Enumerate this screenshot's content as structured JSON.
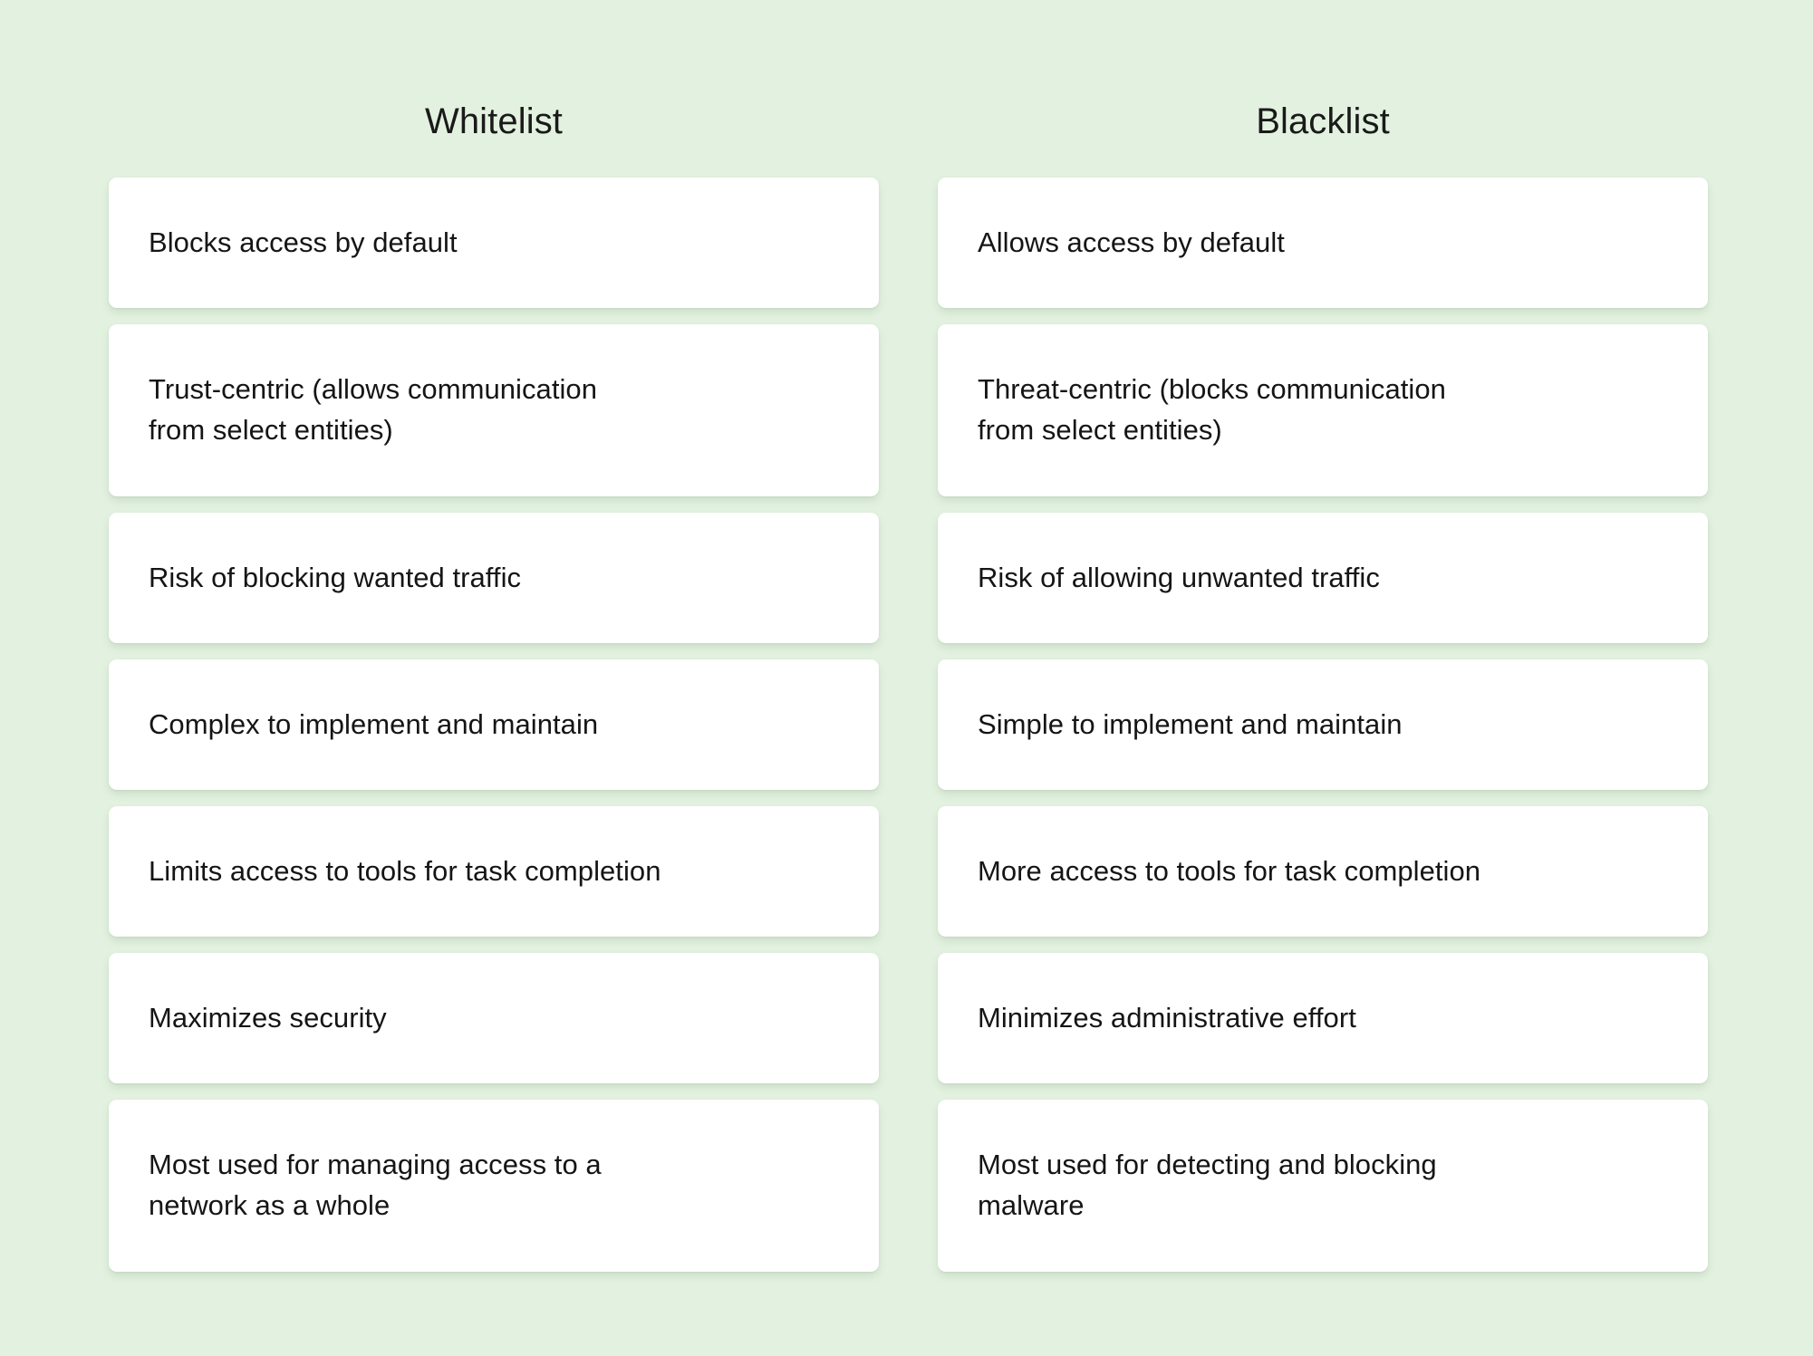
{
  "background_color": "#e3f2e0",
  "card_color": "#ffffff",
  "text_color": "#151515",
  "comparison": {
    "columns": [
      {
        "title": "Whitelist",
        "items": [
          {
            "text": "Blocks access by default",
            "lines": 1
          },
          {
            "text": "Trust-centric (allows communication\nfrom select entities)",
            "lines": 2
          },
          {
            "text": "Risk of blocking wanted traffic",
            "lines": 1
          },
          {
            "text": "Complex to implement and maintain",
            "lines": 1
          },
          {
            "text": "Limits access to tools for task completion",
            "lines": 1
          },
          {
            "text": "Maximizes security",
            "lines": 1
          },
          {
            "text": "Most used for managing access to a\nnetwork as a whole",
            "lines": 2
          }
        ]
      },
      {
        "title": "Blacklist",
        "items": [
          {
            "text": "Allows access by default",
            "lines": 1
          },
          {
            "text": "Threat-centric (blocks communication\nfrom select entities)",
            "lines": 2
          },
          {
            "text": "Risk of allowing unwanted traffic",
            "lines": 1
          },
          {
            "text": "Simple to implement and maintain",
            "lines": 1
          },
          {
            "text": "More access to tools for task completion",
            "lines": 1
          },
          {
            "text": "Minimizes administrative effort",
            "lines": 1
          },
          {
            "text": "Most used for detecting and blocking\nmalware",
            "lines": 2
          }
        ]
      }
    ]
  }
}
